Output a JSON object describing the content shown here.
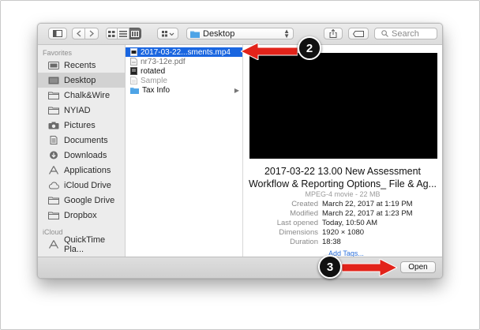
{
  "toolbar": {
    "location_label": "Desktop",
    "search_placeholder": "Search"
  },
  "sidebar": {
    "favorites_header": "Favorites",
    "favorites": [
      {
        "label": "Recents",
        "icon": "clock-icon"
      },
      {
        "label": "Desktop",
        "icon": "desktop-icon",
        "selected": true
      },
      {
        "label": "Chalk&Wire",
        "icon": "folder-icon"
      },
      {
        "label": "NYIAD",
        "icon": "folder-icon"
      },
      {
        "label": "Pictures",
        "icon": "camera-icon"
      },
      {
        "label": "Documents",
        "icon": "document-icon"
      },
      {
        "label": "Downloads",
        "icon": "download-icon"
      },
      {
        "label": "Applications",
        "icon": "applications-icon"
      },
      {
        "label": "iCloud Drive",
        "icon": "cloud-icon"
      },
      {
        "label": "Google Drive",
        "icon": "folder-icon"
      },
      {
        "label": "Dropbox",
        "icon": "folder-icon"
      }
    ],
    "icloud_header": "iCloud",
    "icloud": [
      {
        "label": "QuickTime Pla...",
        "icon": "applications-icon"
      }
    ]
  },
  "files": [
    {
      "name": "2017-03-22...sments.mp4",
      "icon": "video-file-icon",
      "selected": true
    },
    {
      "name": "nr73-12e.pdf",
      "icon": "pdf-file-icon"
    },
    {
      "name": "rotated",
      "icon": "image-file-icon"
    },
    {
      "name": "Sample",
      "icon": "generic-file-icon",
      "dim": true
    },
    {
      "name": "Tax Info",
      "icon": "folder-icon",
      "folder": true
    }
  ],
  "preview": {
    "title_line1": "2017-03-22 13.00 New Assessment",
    "title_line2": "Workflow & Reporting Options_  File & Ag...",
    "kind": "MPEG-4 movie - 22 MB",
    "meta": [
      {
        "key": "Created",
        "value": "March 22, 2017 at 1:19 PM"
      },
      {
        "key": "Modified",
        "value": "March 22, 2017 at 1:23 PM"
      },
      {
        "key": "Last opened",
        "value": "Today, 10:50 AM"
      },
      {
        "key": "Dimensions",
        "value": "1920 × 1080"
      },
      {
        "key": "Duration",
        "value": "18:38"
      }
    ],
    "add_tags": "Add Tags..."
  },
  "bottom": {
    "open_label": "Open"
  },
  "callouts": {
    "step2": "2",
    "step3": "3"
  },
  "colors": {
    "selection": "#1a66e0",
    "arrow": "#e2231a",
    "folder": "#62b0ea"
  }
}
